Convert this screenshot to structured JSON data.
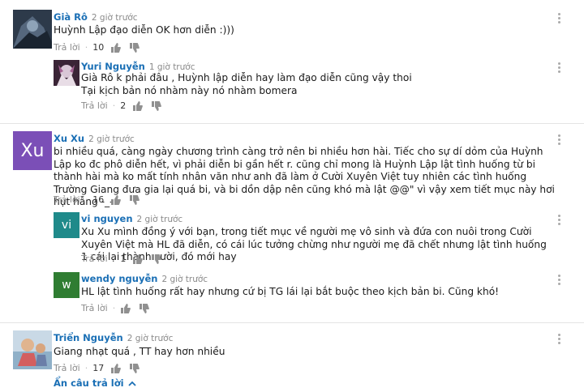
{
  "ui": {
    "reply_label": "Trả lời",
    "more_label": "⋮",
    "hide_replies": "Ẩn câu trả lời"
  },
  "comments": [
    {
      "author": "Già Rô",
      "time": "2 giờ trước",
      "text": "Huỳnh Lập đạo diễn OK hơn diễn :)))",
      "likes": "10"
    },
    {
      "author": "Yuri Nguyễn",
      "time": "1 giờ trước",
      "text": "Già Rô k phải đâu , Huỳnh lập diễn hay làm đạo diễn cũng vậy thoi\nTại kịch bản nó nhàm này nó nhàm bomera",
      "likes": "2"
    },
    {
      "author": "Xu Xu",
      "time": "2 giờ trước",
      "avatar_text": "Xu",
      "text": "bi nhiều quá, càng ngày chương trình càng trở nên bi nhiều hơn hài. Tiếc cho sự dí dỏm của Huỳnh Lập ko đc phô diễn hết, vì phải diễn bi gần hết r. cũng chỉ mong là Huỳnh Lập lật tình huống từ bi thành hài mà ko mất tính nhân văn như anh đã làm ở Cười Xuyên Việt tuy nhiên các tình huống Trường Giang đưa gia lại quá bi, và bi dồn dập nên cũng khó mà lật @@\" vì vậy xem tiết mục này hơi hụt hẫng -_-",
      "likes": "16"
    },
    {
      "author": "vi nguyen",
      "time": "2 giờ trước",
      "avatar_text": "vi",
      "text": "Xu Xu mình đồng ý với bạn, trong tiết mục về người mẹ vô sinh và đứa con nuôi trong Cười Xuyên Việt mà HL đã diễn, có cái lúc tưởng chừng như người mẹ đã chết nhưng lật tình huống 1 cái lại thành cười, đó mới hay",
      "likes": "1"
    },
    {
      "author": "wendy nguyễn",
      "time": "2 giờ trước",
      "avatar_text": "w",
      "text": "HL lật tình huống rất hay nhưng cứ bị TG lái lại bắt buộc theo kịch bản bi. Cũng khó!",
      "likes": ""
    },
    {
      "author": "Triển Nguyễn",
      "time": "2 giờ trước",
      "text": "Giang nhạt quá , TT hay hơn nhiều",
      "likes": "17"
    }
  ],
  "colors": {
    "link": "#1a6fb5",
    "xu_avatar": "#7b4fb7",
    "vi_avatar": "#1f8a8a",
    "w_avatar": "#2f7d32"
  }
}
